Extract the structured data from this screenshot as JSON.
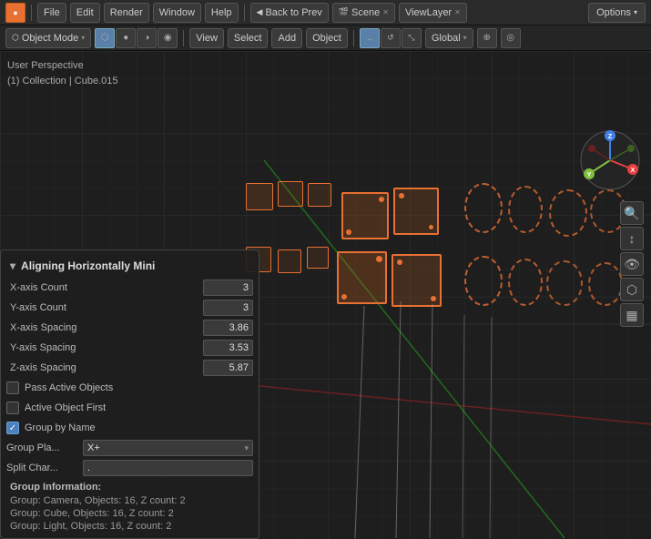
{
  "topbar": {
    "app_icon": "blender-icon",
    "menus": [
      "File",
      "Edit",
      "Render",
      "Window",
      "Help"
    ],
    "back_to_prev": "Back to Prev",
    "scene": "Scene",
    "view_layer": "ViewLayer",
    "object_mode": "Object Mode",
    "view": "View",
    "select": "Select",
    "add": "Add",
    "object": "Object",
    "global": "Global",
    "options": "Options"
  },
  "viewport": {
    "perspective_label": "User Perspective",
    "collection_label": "(1) Collection | Cube.015"
  },
  "panel": {
    "title": "Aligning Horizontally Mini",
    "fields": [
      {
        "label": "X-axis Count",
        "value": "3"
      },
      {
        "label": "Y-axis Count",
        "value": "3"
      },
      {
        "label": "X-axis Spacing",
        "value": "3.86"
      },
      {
        "label": "Y-axis Spacing",
        "value": "3.53"
      },
      {
        "label": "Z-axis Spacing",
        "value": "5.87"
      }
    ],
    "checkboxes": [
      {
        "label": "Pass Active Objects",
        "checked": false
      },
      {
        "label": "Active Object First",
        "checked": false
      },
      {
        "label": "Group by Name",
        "checked": true
      }
    ],
    "group_plane_label": "Group Pla...",
    "group_plane_value": "X+",
    "split_char_label": "Split Char...",
    "split_char_value": ".",
    "section_header": "Group Information:",
    "info_rows": [
      "Group: Camera, Objects: 16, Z count: 2",
      "Group: Cube, Objects: 16, Z count: 2",
      "Group: Light, Objects: 16, Z count: 2"
    ]
  },
  "axis_widget": {
    "x_color": "#e84040",
    "y_color": "#80c040",
    "z_color": "#4080e8",
    "x_label": "X",
    "y_label": "Y",
    "z_label": "Z"
  }
}
